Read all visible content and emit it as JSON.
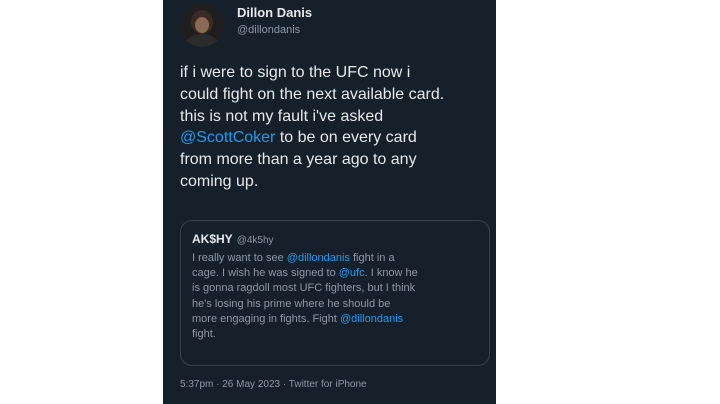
{
  "tweet": {
    "author": {
      "display_name": "Dillon Danis",
      "handle": "@dillondanis"
    },
    "text_lines": [
      [
        {
          "t": "if i were to sign to the UFC now i"
        }
      ],
      [
        {
          "t": "could fight on the next available card."
        }
      ],
      [
        {
          "t": "this is not my fault i've asked"
        }
      ],
      [
        {
          "t": "@ScottCoker",
          "m": true
        },
        {
          "t": " to be on every card"
        }
      ],
      [
        {
          "t": "from more than a year ago to any"
        }
      ],
      [
        {
          "t": "coming up."
        }
      ]
    ],
    "quote": {
      "author_name": "AK$HY",
      "author_handle": "@4k5hy",
      "text_lines": [
        [
          {
            "t": "I really want to see "
          },
          {
            "t": "@dillondanis",
            "m": true
          },
          {
            "t": " fight in a"
          }
        ],
        [
          {
            "t": "cage. I wish he was signed to "
          },
          {
            "t": "@ufc",
            "m": true
          },
          {
            "t": ". I know he"
          }
        ],
        [
          {
            "t": "is gonna ragdoll most UFC fighters, but I think"
          }
        ],
        [
          {
            "t": "he's losing his prime where he should be"
          }
        ],
        [
          {
            "t": "more engaging in fights. Fight "
          },
          {
            "t": "@dillondanis",
            "m": true
          }
        ],
        [
          {
            "t": "fight."
          }
        ]
      ]
    },
    "meta": {
      "time": "5:37pm",
      "separator": " · ",
      "date": "26 May 2023",
      "client": "Twitter for iPhone"
    }
  },
  "colors": {
    "background": "#15202b",
    "text": "#e7e9ea",
    "secondary_text": "#8b98a5",
    "mention": "#1d9bf0",
    "quote_border": "#38444d"
  }
}
